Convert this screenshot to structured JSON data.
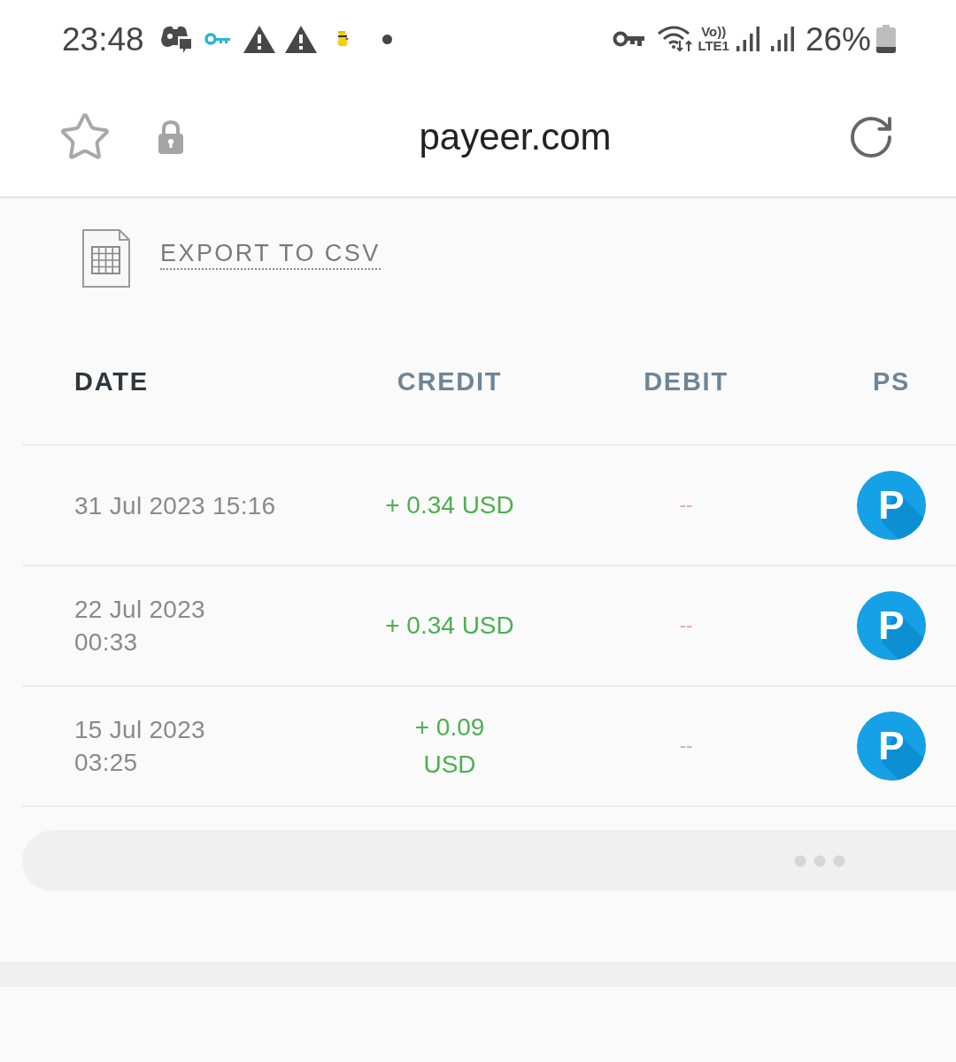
{
  "status_bar": {
    "time": "23:48",
    "volte": {
      "top": "Vo))",
      "bottom": "LTE1"
    },
    "battery": "26%"
  },
  "browser_bar": {
    "url": "payeer.com"
  },
  "export": {
    "label": "EXPORT TO CSV"
  },
  "table": {
    "columns": [
      {
        "label": "DATE",
        "selected": true
      },
      {
        "label": "CREDIT",
        "selected": false
      },
      {
        "label": "DEBIT",
        "selected": false
      },
      {
        "label": "PS",
        "selected": false
      }
    ],
    "rows": [
      {
        "date": [
          "31 Jul 2023 15:16"
        ],
        "credit": [
          "+ 0.34 USD"
        ],
        "debit": "--",
        "ps": "P"
      },
      {
        "date": [
          "22 Jul 2023",
          "00:33"
        ],
        "credit": [
          "+ 0.34 USD"
        ],
        "debit": "--",
        "ps": "P"
      },
      {
        "date": [
          "15 Jul 2023",
          "03:25"
        ],
        "credit": [
          "+ 0.09",
          "USD"
        ],
        "debit": "--",
        "ps": "P"
      }
    ]
  }
}
